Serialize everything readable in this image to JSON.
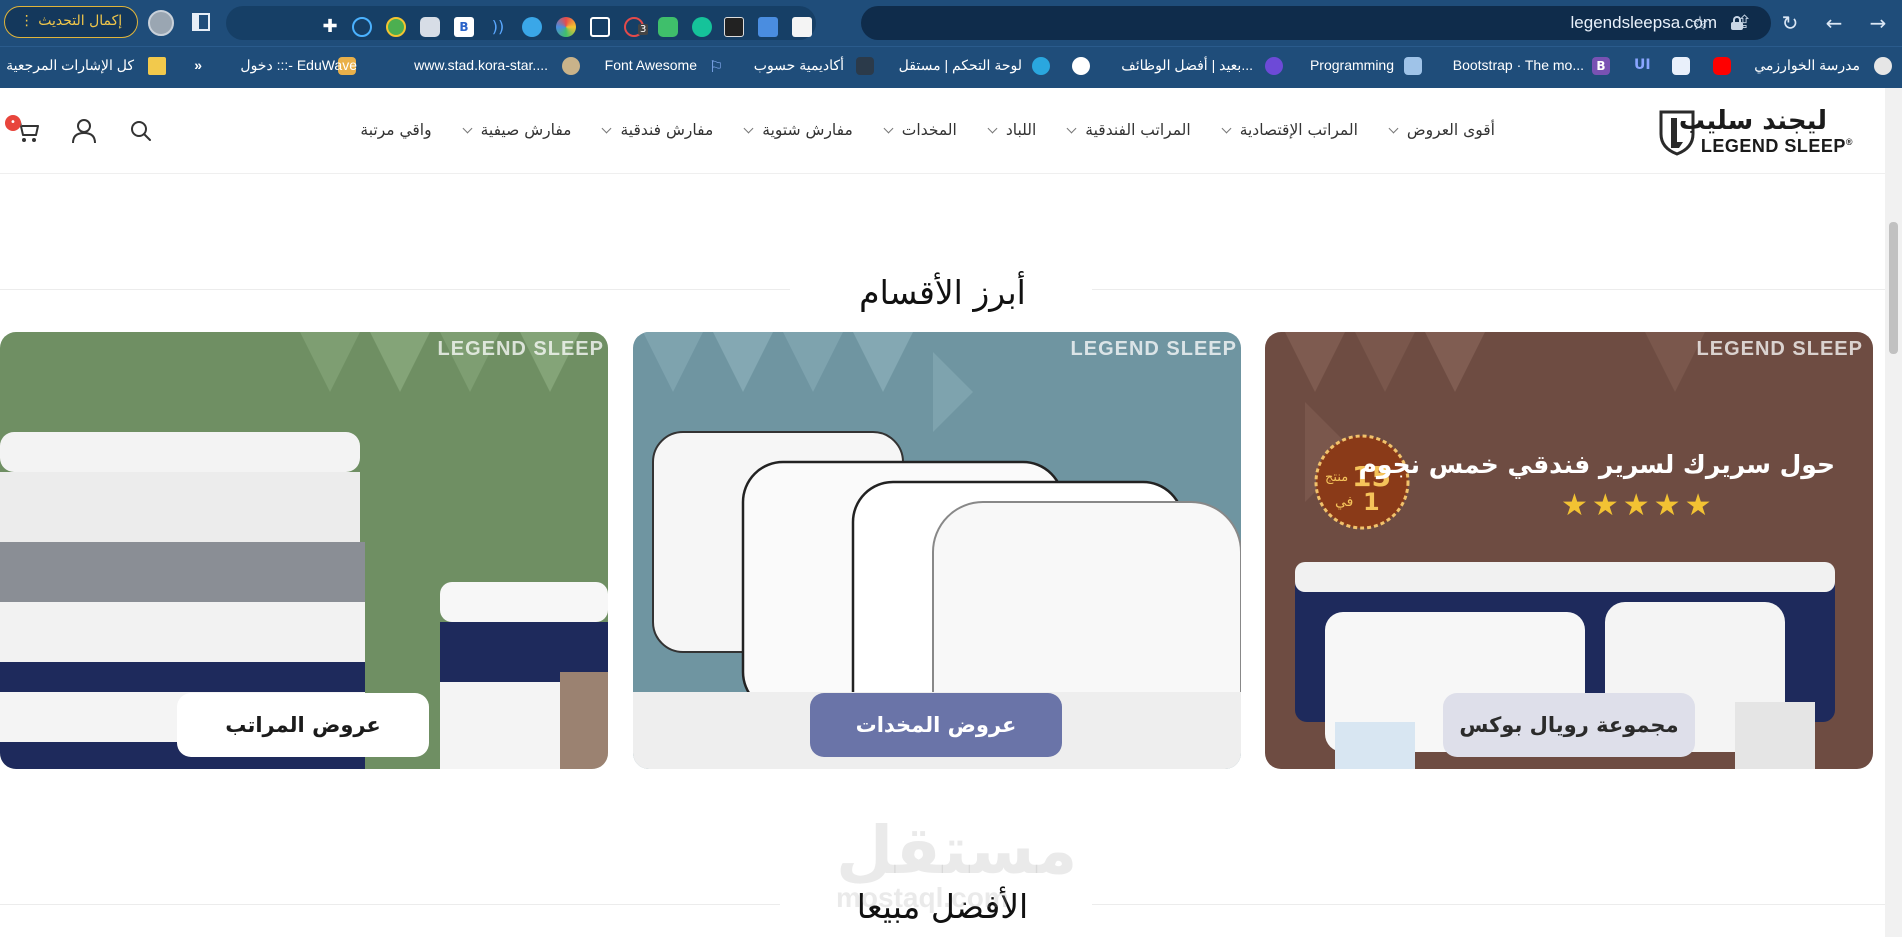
{
  "browser": {
    "url": "legendsleepsa.com",
    "update_button": "إكمال التحديث",
    "extension_badge": "3",
    "bookmarks": [
      {
        "label": "مدرسة الخوارزمي"
      },
      {
        "label": "Bootstrap · The mo..."
      },
      {
        "label": "Programming"
      },
      {
        "label": "بعيد | أفضل الوظائف..."
      },
      {
        "label": "لوحة التحكم | مستقل"
      },
      {
        "label": "أكاديمية حسوب"
      },
      {
        "label": "Font Awesome"
      },
      {
        "label": "www.stad.kora-star...."
      },
      {
        "label": "دخول :::- EduWave"
      },
      {
        "label": "»"
      },
      {
        "label": "كل الإشارات المرجعية"
      }
    ]
  },
  "header": {
    "logo_ar": "ليجند سليب",
    "logo_en": "LEGEND SLEEP",
    "logo_reg": "®",
    "menu": [
      {
        "label": "أقوى العروض",
        "has_caret": true
      },
      {
        "label": "المراتب الإقتصادية",
        "has_caret": true
      },
      {
        "label": "المراتب الفندقية",
        "has_caret": true
      },
      {
        "label": "اللباد",
        "has_caret": true
      },
      {
        "label": "المخدات",
        "has_caret": true
      },
      {
        "label": "مفارش شتوية",
        "has_caret": true
      },
      {
        "label": "مفارش فندقية",
        "has_caret": true
      },
      {
        "label": "مفارش صيفية",
        "has_caret": true
      },
      {
        "label": "واقي مرتبة",
        "has_caret": false
      }
    ]
  },
  "sections": {
    "categories_title": "أبرز الأقسام",
    "bestsellers_title": "الأفضل مبيعا"
  },
  "cards": [
    {
      "label": "مجموعة رويال بوكس",
      "headline": "حول سريرك لسرير فندقي خمس نجوم",
      "badge_number": "15",
      "badge_word": "منتج",
      "badge_in": "في",
      "badge_one": "1",
      "stars": 5,
      "background": "#6e4c42",
      "label_bg": "#dedfea",
      "label_color": "#2b2b2b",
      "brand": "LEGEND SLEEP"
    },
    {
      "label": "عروض المخدات",
      "background": "#6f95a1",
      "label_bg": "#6a74a8",
      "label_color": "#ffffff",
      "brand": "LEGEND SLEEP"
    },
    {
      "label": "عروض المراتب",
      "background": "#6f8f63",
      "label_bg": "#ffffff",
      "label_color": "#1b1b1b",
      "brand": "LEGEND SLEEP"
    }
  ],
  "watermark": {
    "ar": "مستقل",
    "en": "mostaql.com"
  }
}
